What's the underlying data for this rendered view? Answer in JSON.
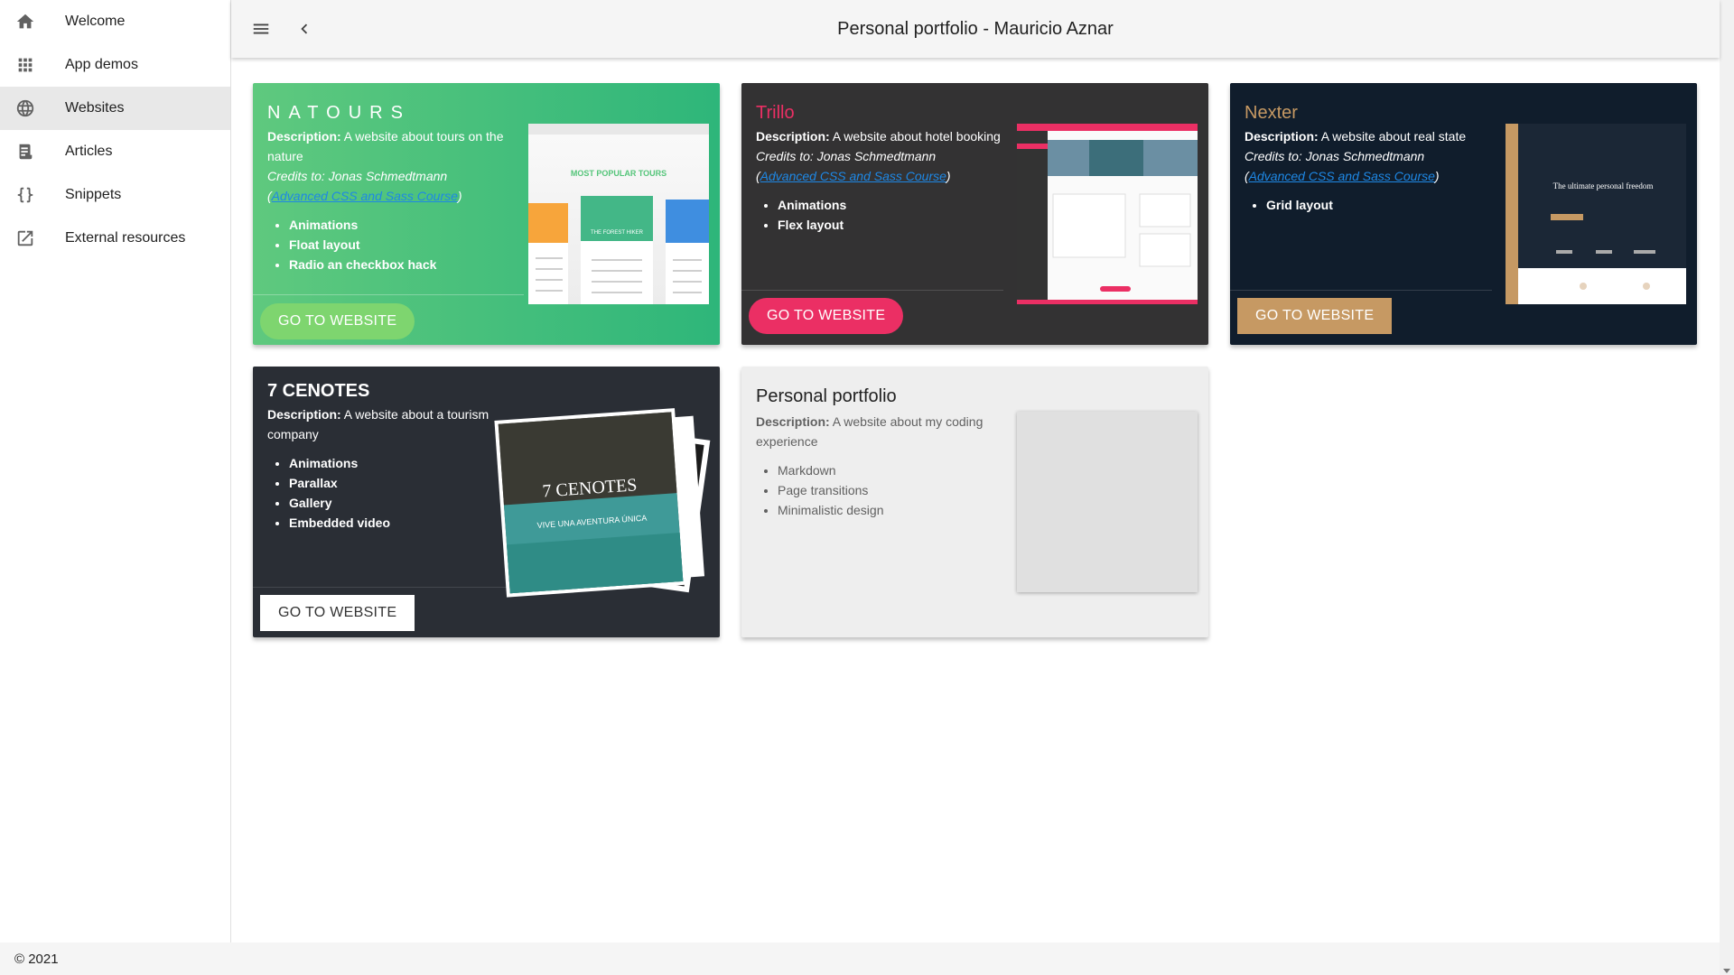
{
  "header": {
    "title": "Personal portfolio - Mauricio Aznar"
  },
  "sidebar": {
    "items": [
      {
        "label": "Welcome",
        "icon": "home-icon"
      },
      {
        "label": "App demos",
        "icon": "apps-icon"
      },
      {
        "label": "Websites",
        "icon": "globe-icon",
        "active": true
      },
      {
        "label": "Articles",
        "icon": "article-icon"
      },
      {
        "label": "Snippets",
        "icon": "braces-icon"
      },
      {
        "label": "External resources",
        "icon": "external-link-icon"
      }
    ]
  },
  "footer": {
    "text": "© 2021"
  },
  "cards": [
    {
      "title": "NATOURS",
      "description_label": "Description:",
      "description": " A website about tours on the nature",
      "credits": "Credits to: Jonas Schmedtmann",
      "link": "Advanced CSS and Sass Course",
      "features": [
        "Animations",
        "Float layout",
        "Radio an checkbox hack"
      ],
      "button": "GO TO WEBSITE",
      "thumb_text": [
        "MOST POPULAR TOURS",
        "THE FOREST HIKER"
      ],
      "accent": "#55c57a"
    },
    {
      "title": "Trillo",
      "description_label": "Description:",
      "description": " A website about hotel booking",
      "credits": "Credits to: Jonas Schmedtmann",
      "link": "Advanced CSS and Sass Course",
      "features": [
        "Animations",
        "Flex layout"
      ],
      "button": "GO TO WEBSITE",
      "accent": "#eb2f64"
    },
    {
      "title": "Nexter",
      "description_label": "Description:",
      "description": " A website about real state",
      "credits": "Credits to: Jonas Schmedtmann",
      "link": "Advanced CSS and Sass Course",
      "features": [
        "Grid layout"
      ],
      "button": "GO TO WEBSITE",
      "thumb_text": [
        "The ultimate personal freedom"
      ],
      "accent": "#c69963"
    },
    {
      "title": "7 CENOTES",
      "description_label": "Description:",
      "description": " A website about a tourism company",
      "features": [
        "Animations",
        "Parallax",
        "Gallery",
        "Embedded video"
      ],
      "button": "GO TO WEBSITE",
      "thumb_text": [
        "7 CENOTES",
        "VIVE UNA AVENTURA ÚNICA"
      ],
      "accent": "#2a2e35"
    },
    {
      "title": "Personal portfolio",
      "description_label": "Description:",
      "description": " A website about my coding experience",
      "features": [
        "Markdown",
        "Page transitions",
        "Minimalistic design"
      ],
      "accent": "#eeeeee"
    }
  ]
}
